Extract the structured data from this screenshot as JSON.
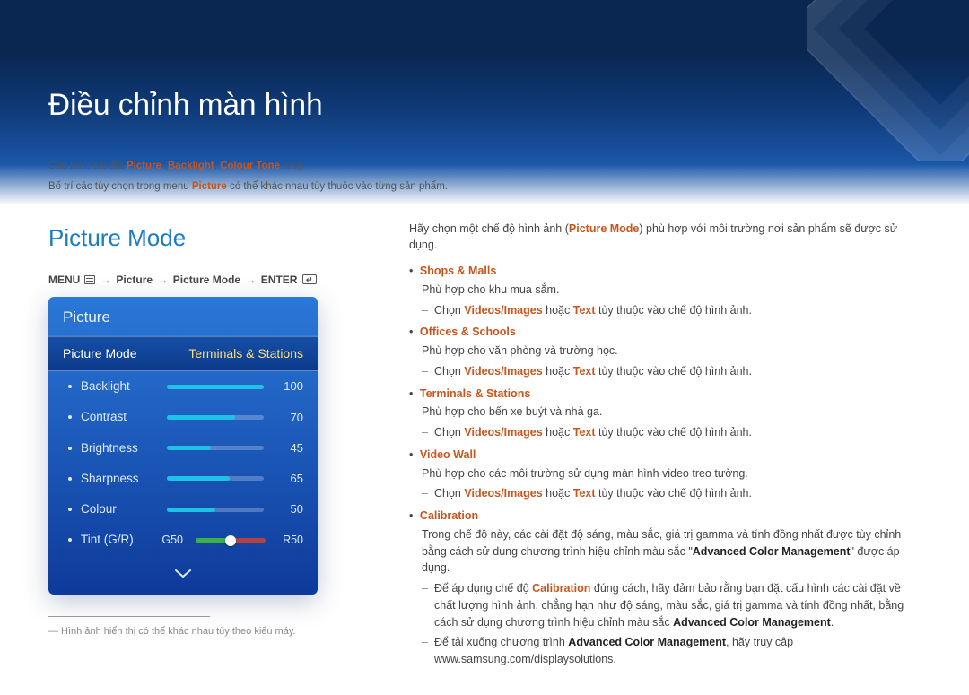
{
  "page": {
    "title": "Điều chỉnh màn hình"
  },
  "intro": {
    "line1_pre": "Cấu hình cài đặt ",
    "line1_picture": "Picture",
    "line1_mid1": " (",
    "line1_bl": "Backlight",
    "line1_sep": ", ",
    "line1_ct": "Colour Tone",
    "line1_post": ", v.v).",
    "line2_pre": "Bố trí các tùy chọn trong menu ",
    "line2_picture": "Picture",
    "line2_post": " có thể khác nhau tùy thuộc vào từng sản phẩm."
  },
  "section": {
    "title": "Picture Mode"
  },
  "breadcrumb": {
    "menu": "MENU",
    "sep": "→",
    "p1": "Picture",
    "p2": "Picture Mode",
    "enter": "ENTER"
  },
  "osd": {
    "header": "Picture",
    "selected_label": "Picture Mode",
    "selected_value": "Terminals & Stations",
    "items": [
      {
        "label": "Backlight",
        "value": 100,
        "pct": 100
      },
      {
        "label": "Contrast",
        "value": 70,
        "pct": 70
      },
      {
        "label": "Brightness",
        "value": 45,
        "pct": 45
      },
      {
        "label": "Sharpness",
        "value": 65,
        "pct": 65
      },
      {
        "label": "Colour",
        "value": 50,
        "pct": 50
      }
    ],
    "tint": {
      "label": "Tint (G/R)",
      "g": "G50",
      "r": "R50"
    }
  },
  "footnote": "― Hình ảnh hiển thị có thể khác nhau tùy theo kiểu máy.",
  "right": {
    "lead_pre": "Hãy chọn một chế độ hình ảnh (",
    "lead_pm": "Picture Mode",
    "lead_post": ") phù hợp với môi trường nơi sản phẩm sẽ được sử dụng.",
    "common_sub_pre": "Chọn ",
    "common_sub_vi": "Videos/Images",
    "common_sub_mid": " hoặc ",
    "common_sub_tx": "Text",
    "common_sub_post": " tùy thuộc vào chế độ hình ảnh.",
    "modes": [
      {
        "name": "Shops & Malls",
        "desc": "Phù hợp cho khu mua sắm.",
        "simple_sub": true
      },
      {
        "name": "Offices & Schools",
        "desc": "Phù hợp cho văn phòng và trường học.",
        "simple_sub": true
      },
      {
        "name": "Terminals & Stations",
        "desc": "Phù hợp cho bến xe buýt và nhà ga.",
        "simple_sub": true
      },
      {
        "name": "Video Wall",
        "desc": "Phù hợp cho các môi trường sử dụng màn hình video treo tường.",
        "simple_sub": true
      },
      {
        "name": "Calibration",
        "desc": "",
        "simple_sub": false
      }
    ],
    "calibration": {
      "desc_pre": "Trong chế độ này, các cài đặt độ sáng, màu sắc, giá trị gamma và tính đồng nhất được tùy chỉnh bằng cách sử dụng chương trình hiệu chỉnh màu sắc \"",
      "desc_acm": "Advanced Color Management",
      "desc_post": "\" được áp dụng.",
      "s1_pre": "Để áp dụng chế độ ",
      "s1_cal": "Calibration",
      "s1_mid": " đúng cách, hãy đảm bảo rằng bạn đặt cấu hình các cài đặt về chất lượng hình ảnh, chẳng hạn như độ sáng, màu sắc, giá trị gamma và tính đồng nhất, bằng cách sử dụng chương trình hiệu chỉnh màu sắc ",
      "s1_acm": "Advanced Color Management",
      "s1_post": ".",
      "s2_pre": "Để tải xuống chương trình ",
      "s2_acm": "Advanced Color Management",
      "s2_mid": ", hãy truy cập www.samsung.com/displaysolutions."
    }
  }
}
